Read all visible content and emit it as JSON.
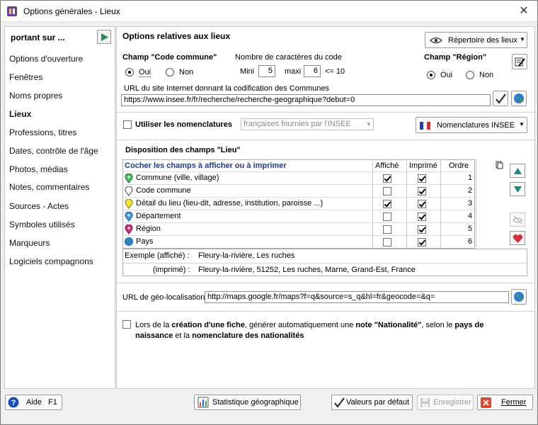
{
  "window": {
    "title": "Options générales - Lieux",
    "close_glyph": "✕"
  },
  "left": {
    "heading": "portant sur ...",
    "items": [
      {
        "label": "Options d'ouverture",
        "active": false
      },
      {
        "label": "Fenêtres",
        "active": false
      },
      {
        "label": "Noms propres",
        "active": false
      },
      {
        "label": "Lieux",
        "active": true
      },
      {
        "label": "Professions, titres",
        "active": false
      },
      {
        "label": "Dates, contrôle de l'âge",
        "active": false
      },
      {
        "label": "Photos, médias",
        "active": false
      },
      {
        "label": "Notes, commentaires",
        "active": false
      },
      {
        "label": "Sources - Actes",
        "active": false
      },
      {
        "label": "Symboles utilisés",
        "active": false
      },
      {
        "label": "Marqueurs",
        "active": false
      },
      {
        "label": "Logiciels compagnons",
        "active": false
      }
    ]
  },
  "main": {
    "title": "Options relatives aux lieux",
    "repertoire_button": "Répertoire des lieux",
    "code_commune": {
      "label": "Champ \"Code commune\"",
      "oui": "Oui",
      "non": "Non",
      "selected": "Oui"
    },
    "nb_chars": {
      "label": "Nombre de caractères du code",
      "mini_label": "Mini",
      "mini": "5",
      "maxi_label": "maxi",
      "maxi": "6",
      "limit": "<= 10"
    },
    "region": {
      "label": "Champ \"Région\"",
      "oui": "Oui",
      "non": "Non",
      "selected": "Oui"
    },
    "url_codif": {
      "label": "URL du site Internet donnant la codification des Communes",
      "value": "https://www.insee.fr/fr/recherche/recherche-geographique?debut=0"
    },
    "nomenclatures": {
      "label": "Utiliser les nomenclatures",
      "checked": false,
      "combo": "françaises fournies par l'INSEE",
      "button": "Nomenclatures INSEE"
    },
    "disposition": {
      "title": "Disposition des champs \"Lieu\"",
      "headers": {
        "field": "Cocher les champs à afficher ou à imprimer",
        "shown": "Affiché",
        "printed": "Imprimé",
        "order": "Ordre"
      },
      "rows": [
        {
          "label": "Commune (ville, village)",
          "icon": "green-pin-icon",
          "shown": true,
          "printed": true,
          "order": "1"
        },
        {
          "label": "Code commune",
          "icon": "white-pin-icon",
          "shown": false,
          "printed": true,
          "order": "2"
        },
        {
          "label": "Détail du lieu (lieu-dit, adresse, institution, paroisse ...)",
          "icon": "yellow-pin-icon",
          "shown": true,
          "printed": true,
          "order": "3"
        },
        {
          "label": "Département",
          "icon": "blue-pin-icon",
          "shown": false,
          "printed": true,
          "order": "4"
        },
        {
          "label": "Région",
          "icon": "red-pin-icon",
          "shown": false,
          "printed": true,
          "order": "5"
        },
        {
          "label": "Pays",
          "icon": "globe-icon",
          "shown": false,
          "printed": true,
          "order": "6"
        }
      ],
      "example_shown_label": "Exemple (affiché) :",
      "example_shown": "Fleury-la-rivière, Les ruches",
      "example_printed_label": "(imprimé) :",
      "example_printed": "Fleury-la-rivière, 51252, Les ruches, Marne, Grand-Est, France"
    },
    "geo_url": {
      "label": "URL de géo-localisation",
      "value": "http://maps.google.fr/maps?f=q&source=s_q&hl=fr&geocode=&q="
    },
    "nationalite": {
      "checked": false,
      "t1": "Lors de la ",
      "b1": "création d'une fiche",
      "t2": ", générer automatiquement une ",
      "b2": "note \"Nationalité\"",
      "t3": ", selon le ",
      "b3": "pays de naissance",
      "t4": " et la ",
      "b4": "nomenclature des nationalités"
    }
  },
  "bottom": {
    "aide": "Aide",
    "aide_key": "F1",
    "stat": "Statistique géographique",
    "defaults": "Valeurs par défaut",
    "save": "Enregistrer",
    "close": "Fermer"
  },
  "colors": {
    "link_blue": "#1f3a93",
    "accent_green": "#2e8b2e",
    "heart_red": "#d6303a"
  }
}
